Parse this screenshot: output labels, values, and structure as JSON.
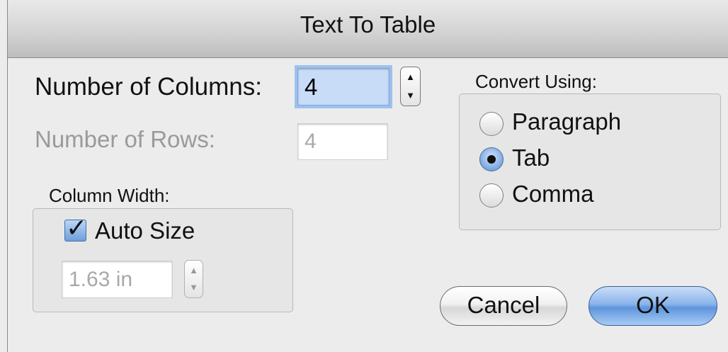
{
  "window": {
    "title": "Text To Table"
  },
  "dimensions": {
    "columns_label": "Number of Columns:",
    "columns_value": "4",
    "rows_label": "Number of Rows:",
    "rows_value": "4"
  },
  "column_width": {
    "group_title": "Column Width:",
    "auto_size_label": "Auto Size",
    "auto_size_checked": true,
    "width_value": "1.63 in"
  },
  "convert_using": {
    "group_title": "Convert Using:",
    "options": [
      {
        "label": "Paragraph",
        "selected": false
      },
      {
        "label": "Tab",
        "selected": true
      },
      {
        "label": "Comma",
        "selected": false
      }
    ]
  },
  "buttons": {
    "cancel_label": "Cancel",
    "ok_label": "OK"
  },
  "icons": {
    "stepper_up": "▲",
    "stepper_down": "▼",
    "checkmark": "✓"
  },
  "colors": {
    "accent": "#6d9fdc",
    "focus_ring": "#9cc1ee"
  }
}
